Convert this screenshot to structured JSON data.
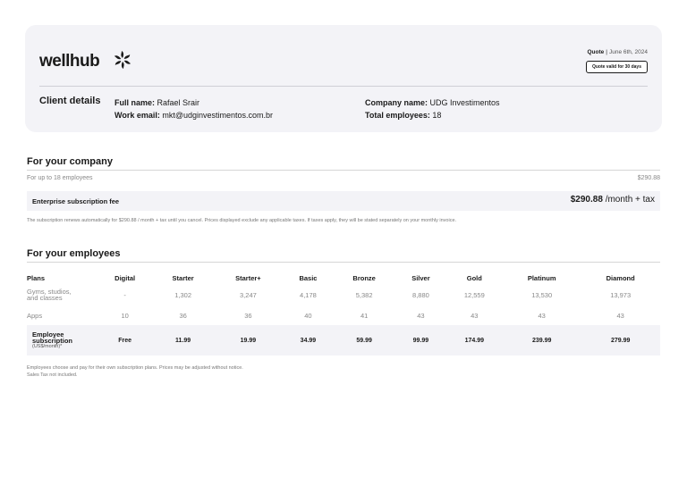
{
  "header": {
    "logo_text": "wellhub",
    "quote_label": "Quote",
    "quote_date": "June 6th, 2024",
    "valid_badge": "Quote valid for 30 days"
  },
  "client": {
    "title": "Client details",
    "full_name_label": "Full name:",
    "full_name": "Rafael Srair",
    "work_email_label": "Work email:",
    "work_email": "mkt@udginvestimentos.com.br",
    "company_name_label": "Company name:",
    "company_name": "UDG Investimentos",
    "total_employees_label": "Total employees:",
    "total_employees": "18"
  },
  "company": {
    "title": "For your company",
    "employees_line": "For up to 18 employees",
    "employees_price": "$290.88",
    "fee_label": "Enterprise subscription fee",
    "fee_amount": "$290.88",
    "fee_suffix": "/month + tax",
    "note": "The subscription renews automatically for $290.88 / month + tax until you cancel. Prices displayed exclude any applicable taxes. If taxes apply, they will be stated separately on your monthly invoice."
  },
  "employees": {
    "title": "For your employees",
    "plans_header": "Plans",
    "plans": [
      "Digital",
      "Starter",
      "Starter+",
      "Basic",
      "Bronze",
      "Silver",
      "Gold",
      "Platinum",
      "Diamond"
    ],
    "gyms_label_1": "Gyms, studios,",
    "gyms_label_2": "and classes",
    "gyms": [
      "-",
      "1,302",
      "3,247",
      "4,178",
      "5,382",
      "8,880",
      "12,559",
      "13,530",
      "13,973"
    ],
    "apps_label": "Apps",
    "apps": [
      "10",
      "36",
      "36",
      "40",
      "41",
      "43",
      "43",
      "43",
      "43"
    ],
    "sub_label_1": "Employee",
    "sub_label_2": "subscription",
    "sub_label_3": "(US$/month)*",
    "subscription": [
      "Free",
      "11.99",
      "19.99",
      "34.99",
      "59.99",
      "99.99",
      "174.99",
      "239.99",
      "279.99"
    ],
    "note_1": "Employees choose and pay for their own subscription plans. Prices may be adjusted without notice.",
    "note_2": "Sales Tax not included."
  }
}
